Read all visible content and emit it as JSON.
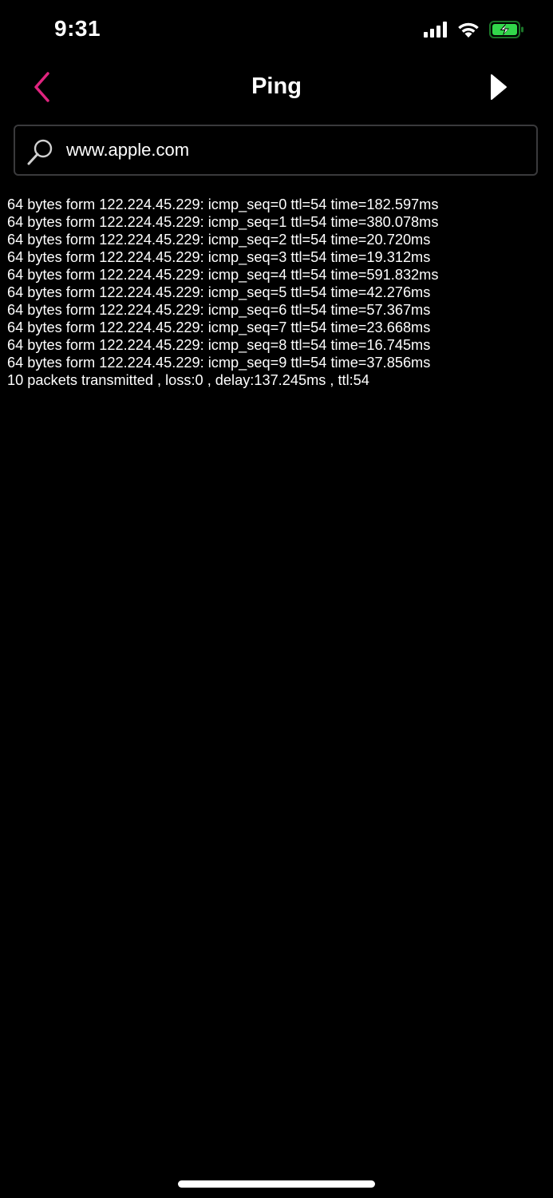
{
  "status_bar": {
    "time": "9:31",
    "icons": [
      "signal-icon",
      "wifi-icon",
      "battery-charging-icon"
    ],
    "battery_color": "#32d74b"
  },
  "nav": {
    "title": "Ping",
    "back_icon": "chevron-left-icon",
    "run_icon": "play-icon",
    "accent_color": "#e0247f"
  },
  "search": {
    "value": "www.apple.com",
    "icon": "search-icon"
  },
  "output": {
    "lines": [
      "64 bytes form 122.224.45.229: icmp_seq=0 ttl=54 time=182.597ms",
      "64 bytes form 122.224.45.229: icmp_seq=1 ttl=54 time=380.078ms",
      "64 bytes form 122.224.45.229: icmp_seq=2 ttl=54 time=20.720ms",
      "64 bytes form 122.224.45.229: icmp_seq=3 ttl=54 time=19.312ms",
      "64 bytes form 122.224.45.229: icmp_seq=4 ttl=54 time=591.832ms",
      "64 bytes form 122.224.45.229: icmp_seq=5 ttl=54 time=42.276ms",
      "64 bytes form 122.224.45.229: icmp_seq=6 ttl=54 time=57.367ms",
      "64 bytes form 122.224.45.229: icmp_seq=7 ttl=54 time=23.668ms",
      "64 bytes form 122.224.45.229: icmp_seq=8 ttl=54 time=16.745ms",
      "64 bytes form 122.224.45.229: icmp_seq=9 ttl=54 time=37.856ms",
      "10 packets transmitted , loss:0 , delay:137.245ms , ttl:54"
    ]
  }
}
